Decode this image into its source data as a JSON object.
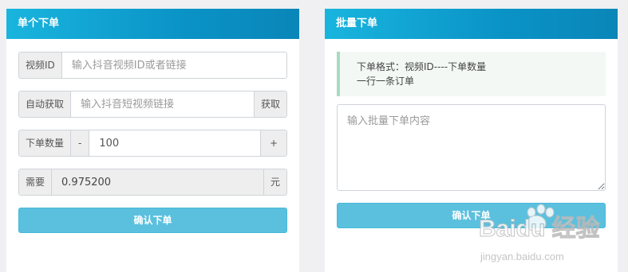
{
  "single": {
    "title": "单个下单",
    "video_id_label": "视频ID",
    "video_id_placeholder": "输入抖音视频ID或者链接",
    "auto_fetch_label": "自动获取",
    "auto_fetch_placeholder": "输入抖音短视频链接",
    "fetch_button": "获取",
    "quantity_label": "下单数量",
    "minus": "-",
    "quantity_value": "100",
    "plus": "+",
    "need_label": "需要",
    "need_value": "0.975200",
    "currency": "元",
    "confirm_button": "确认下单"
  },
  "batch": {
    "title": "批量下单",
    "format_line1": "下单格式：视频ID----下单数量",
    "format_line2": "一行一条订单",
    "textarea_placeholder": "输入批量下单内容",
    "confirm_button": "确认下单"
  },
  "watermark": {
    "brand": "Baidu 经验",
    "url": "jingyan.baidu.com"
  },
  "colors": {
    "header_gradient_start": "#19b5de",
    "header_gradient_end": "#0a86b8",
    "button": "#5bc0de",
    "alert_border": "#a6dcbf"
  }
}
